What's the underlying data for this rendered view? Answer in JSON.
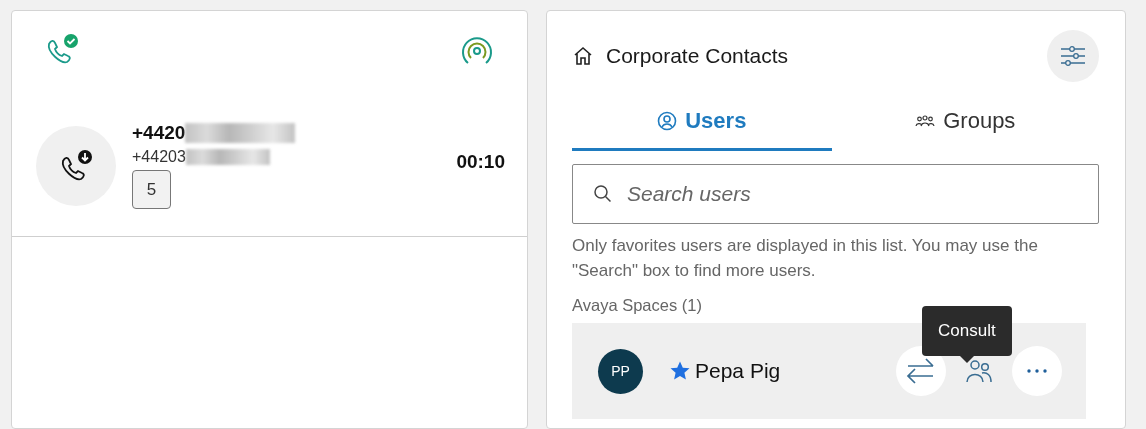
{
  "call_panel": {
    "call": {
      "number": "+4420",
      "number_secondary": "+44203",
      "badge": "5",
      "duration": "00:10"
    }
  },
  "contacts": {
    "title": "Corporate Contacts",
    "tabs": [
      {
        "label": "Users",
        "selected": true
      },
      {
        "label": "Groups",
        "selected": false
      }
    ],
    "search": {
      "placeholder": "Search users"
    },
    "note": "Only favorites users are displayed in this list. You may use the \"Search\" box to find more users.",
    "section": "Avaya Spaces (1)",
    "users": [
      {
        "initials": "PP",
        "name": "Pepa Pig",
        "favorite": true
      }
    ],
    "tooltip": "Consult"
  }
}
